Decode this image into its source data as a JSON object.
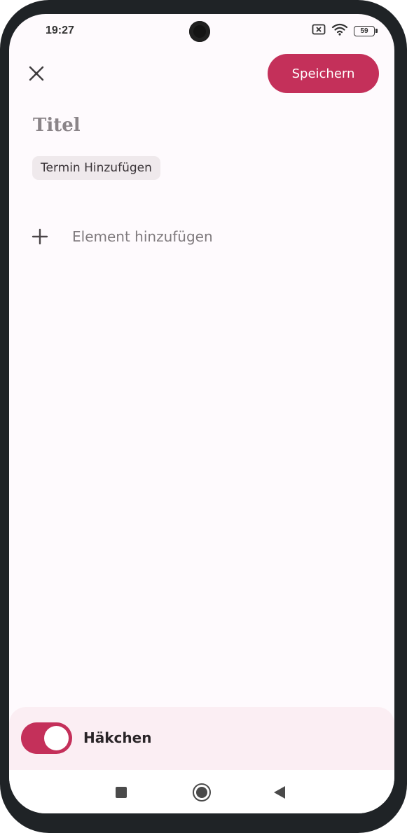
{
  "status_bar": {
    "time": "19:27",
    "battery": "59",
    "icons": [
      "no-sim-icon",
      "wifi-icon",
      "battery-icon"
    ]
  },
  "top_bar": {
    "close_icon": "close-icon",
    "save_label": "Speichern"
  },
  "editor": {
    "title_placeholder": "Titel",
    "chip_label": "Termin Hinzufügen",
    "add_element_label": "Element hinzufügen",
    "add_icon": "plus-icon"
  },
  "bottom_panel": {
    "toggle_label": "Häkchen",
    "toggle_on": true
  },
  "nav_bar": {
    "icons": [
      "recent-apps-icon",
      "home-icon",
      "back-icon"
    ]
  },
  "colors": {
    "accent": "#c4305a",
    "background": "#fefafd",
    "panel": "#fbeef3",
    "chip": "#efe9ec"
  }
}
